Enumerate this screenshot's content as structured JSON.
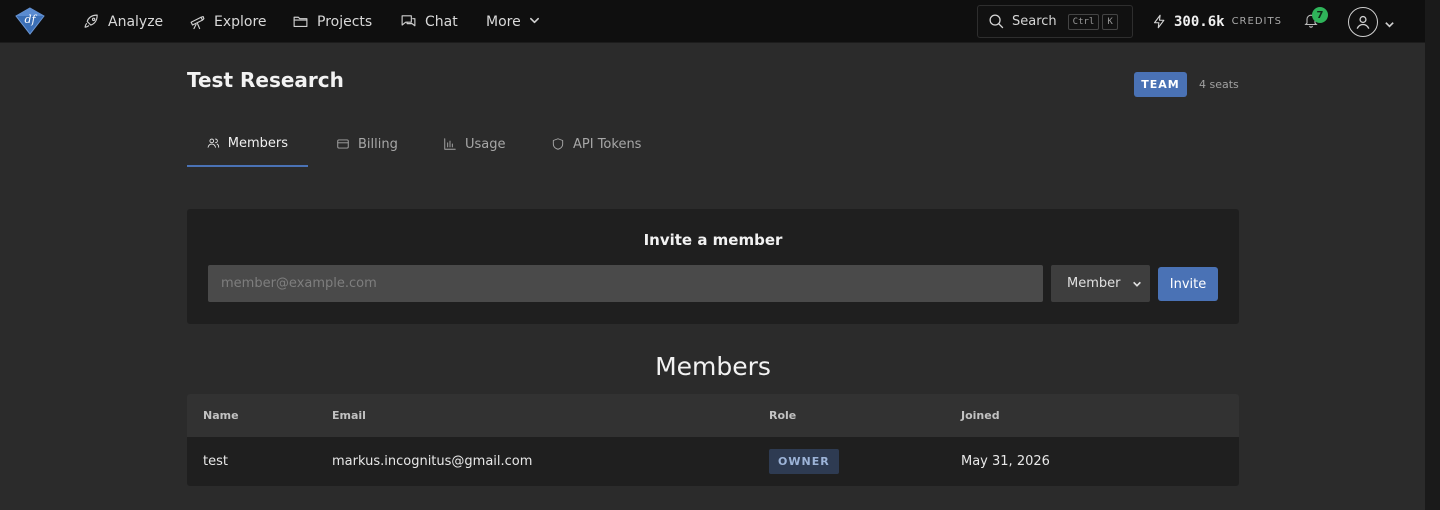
{
  "nav": {
    "items": [
      {
        "label": "Analyze",
        "icon": "rocket-icon"
      },
      {
        "label": "Explore",
        "icon": "telescope-icon"
      },
      {
        "label": "Projects",
        "icon": "folder-icon"
      },
      {
        "label": "Chat",
        "icon": "chat-icon"
      },
      {
        "label": "More",
        "icon": "chevron-down-icon"
      }
    ],
    "search_label": "Search",
    "search_shortcut": [
      "Ctrl",
      "K"
    ],
    "credits_value": "300.6k",
    "credits_label": "CREDITS",
    "notification_count": "7"
  },
  "header": {
    "title": "Test Research",
    "plan_badge": "TEAM",
    "seats": "4 seats"
  },
  "tabs": [
    {
      "label": "Members",
      "icon": "users-icon",
      "active": true
    },
    {
      "label": "Billing",
      "icon": "card-icon",
      "active": false
    },
    {
      "label": "Usage",
      "icon": "bar-chart-icon",
      "active": false
    },
    {
      "label": "API Tokens",
      "icon": "shield-icon",
      "active": false
    }
  ],
  "invite": {
    "title": "Invite a member",
    "email_placeholder": "member@example.com",
    "email_value": "",
    "role_selected": "Member",
    "button_label": "Invite"
  },
  "members": {
    "heading": "Members",
    "columns": [
      "Name",
      "Email",
      "Role",
      "Joined"
    ],
    "rows": [
      {
        "name": "test",
        "email": "markus.incognitus@gmail.com",
        "role": "OWNER",
        "joined": "May 31, 2026"
      }
    ]
  },
  "colors": {
    "accent": "#4a72b5",
    "nav_bg": "#0f0f0f",
    "page_bg": "#2b2b2b",
    "card_bg": "#1f1f1f",
    "notification_green": "#2fb45a"
  }
}
